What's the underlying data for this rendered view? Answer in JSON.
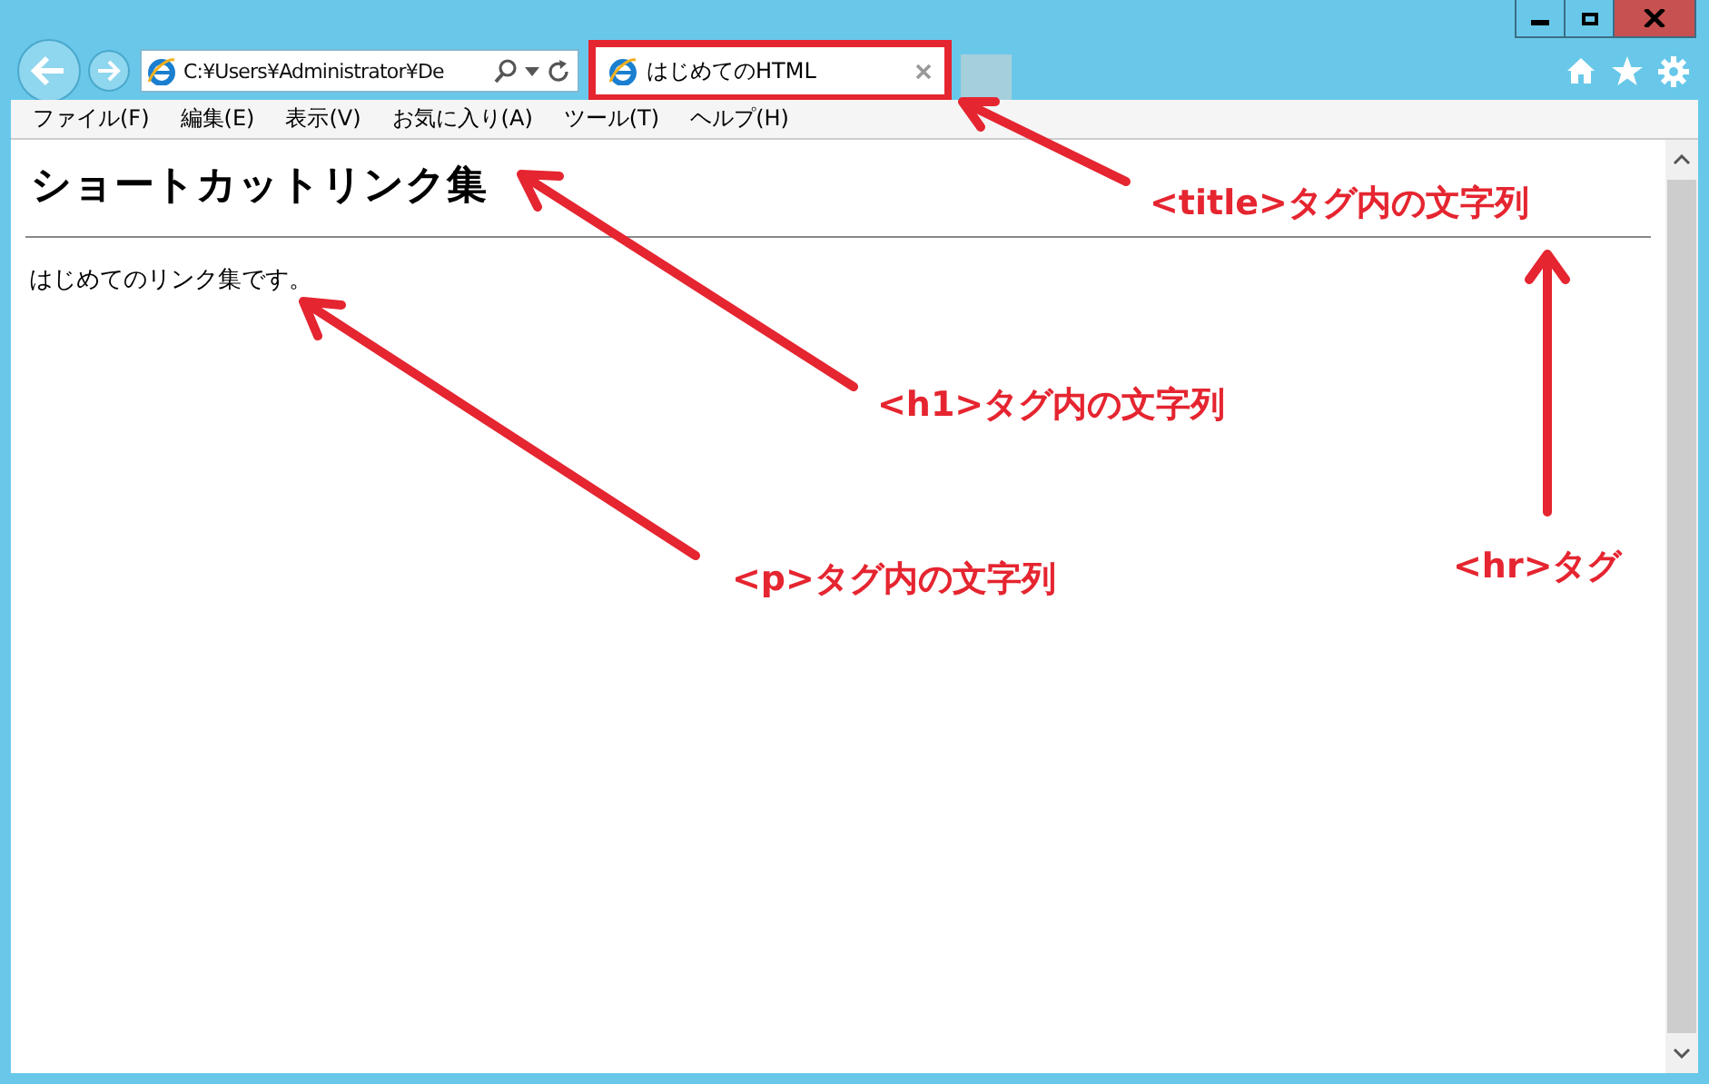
{
  "browser": {
    "address": "C:¥Users¥Administrator¥De",
    "tabs": [
      {
        "title": "はじめてのHTML",
        "selected": true,
        "highlighted": true
      }
    ],
    "menu": [
      {
        "label": "ファイル(F)"
      },
      {
        "label": "編集(E)"
      },
      {
        "label": "表示(V)"
      },
      {
        "label": "お気に入り(A)"
      },
      {
        "label": "ツール(T)"
      },
      {
        "label": "ヘルプ(H)"
      }
    ]
  },
  "page": {
    "heading": "ショートカットリンク集",
    "paragraph": "はじめてのリンク集です。"
  },
  "annotations": [
    {
      "text": "<title>タグ内の文字列",
      "kind": "title"
    },
    {
      "text": "<h1>タグ内の文字列",
      "kind": "h1"
    },
    {
      "text": "<p>タグ内の文字列",
      "kind": "p"
    },
    {
      "text": "<hr>タグ",
      "kind": "hr"
    }
  ]
}
